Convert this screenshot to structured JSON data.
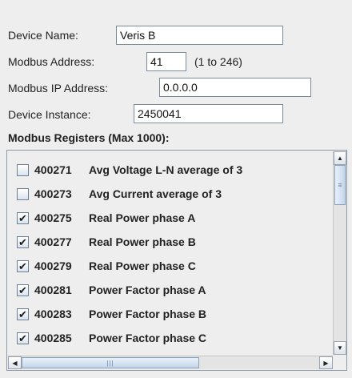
{
  "form": {
    "device_name": {
      "label": "Device Name:",
      "value": "Veris B"
    },
    "modbus_address": {
      "label": "Modbus Address:",
      "value": "41",
      "hint": "(1 to 246)"
    },
    "modbus_ip": {
      "label": "Modbus IP Address:",
      "value": "0.0.0.0"
    },
    "device_instance": {
      "label": "Device Instance:",
      "value": "2450041"
    }
  },
  "registers": {
    "title": "Modbus Registers (Max 1000):",
    "items": [
      {
        "id": "400271",
        "desc": "Avg Voltage L-N average of 3",
        "checked": false
      },
      {
        "id": "400273",
        "desc": "Avg Current average of 3",
        "checked": false
      },
      {
        "id": "400275",
        "desc": "Real Power phase A",
        "checked": true
      },
      {
        "id": "400277",
        "desc": "Real Power phase B",
        "checked": true
      },
      {
        "id": "400279",
        "desc": "Real Power phase C",
        "checked": true
      },
      {
        "id": "400281",
        "desc": "Power Factor phase A",
        "checked": true
      },
      {
        "id": "400283",
        "desc": "Power Factor phase B",
        "checked": true
      },
      {
        "id": "400285",
        "desc": "Power Factor phase C",
        "checked": true
      }
    ]
  },
  "icons": {
    "checkmark": "✔",
    "up": "▲",
    "down": "▼",
    "left": "◀",
    "right": "▶",
    "vgrip": "≡",
    "hgrip": "|||"
  },
  "colors": {
    "background": "#eeeeee",
    "field_border": "#7a8a99",
    "scroll_thumb": "#c4d6ea"
  }
}
